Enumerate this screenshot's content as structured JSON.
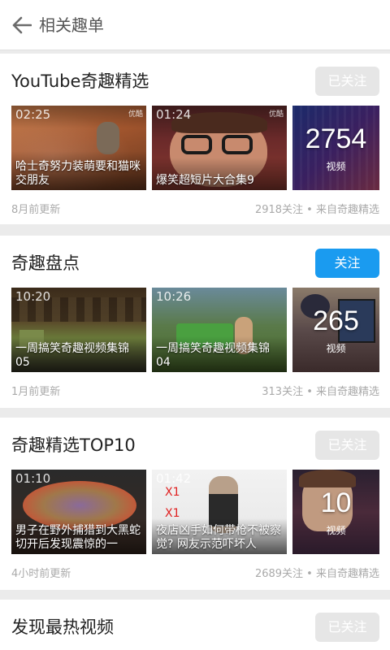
{
  "header": {
    "title": "相关趣单"
  },
  "sections": [
    {
      "title": "YouTube奇趣精选",
      "follow_label": "已关注",
      "videos": [
        {
          "duration": "02:25",
          "source": "优酷",
          "caption": "哈士奇努力装萌要和猫咪交朋友"
        },
        {
          "duration": "01:24",
          "source": "优酷",
          "caption": "爆笑超短片大合集9"
        }
      ],
      "count": {
        "number": "2754",
        "label": "视频"
      },
      "updated": "8月前更新",
      "meta": "2918关注 • 来自奇趣精选"
    },
    {
      "title": "奇趣盘点",
      "follow_label": "关注",
      "videos": [
        {
          "duration": "10:20",
          "caption": "一周搞笑奇趣视频集锦05"
        },
        {
          "duration": "10:26",
          "caption": "一周搞笑奇趣视频集锦04"
        }
      ],
      "count": {
        "number": "265",
        "label": "视频"
      },
      "updated": "1月前更新",
      "meta": "313关注 • 来自奇趣精选"
    },
    {
      "title": "奇趣精选TOP10",
      "follow_label": "已关注",
      "videos": [
        {
          "duration": "01:10",
          "caption": "男子在野外捕猎到大黑蛇 切开后发现震惊的一"
        },
        {
          "duration": "01:42",
          "caption": "夜店凶手如何带枪不被察觉? 网友示范吓坏人"
        }
      ],
      "count": {
        "number": "10",
        "label": "视频"
      },
      "updated": "4小时前更新",
      "meta": "2689关注 • 来自奇趣精选"
    },
    {
      "title": "发现最热视频",
      "follow_label": "已关注"
    }
  ]
}
